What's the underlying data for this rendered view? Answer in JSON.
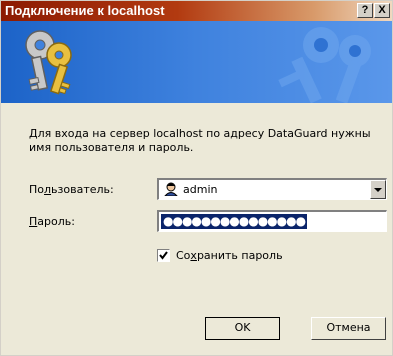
{
  "window": {
    "title": "Подключение к localhost",
    "help_label": "?",
    "close_label": "X"
  },
  "message": "Для входа на сервер localhost по адресу DataGuard нужны имя пользователя и пароль.",
  "user_field": {
    "label_pre": "По",
    "label_accel": "л",
    "label_post": "ьзователь:",
    "value": "admin",
    "icon": "user-icon"
  },
  "password_field": {
    "label_accel": "П",
    "label_post": "ароль:",
    "masked_value": "●●●●●●●●●●●●●●●"
  },
  "save_password": {
    "label_pre": "Со",
    "label_accel": "х",
    "label_post": "ранить пароль",
    "checked": true
  },
  "buttons": {
    "ok": "OK",
    "cancel": "Отмена"
  }
}
